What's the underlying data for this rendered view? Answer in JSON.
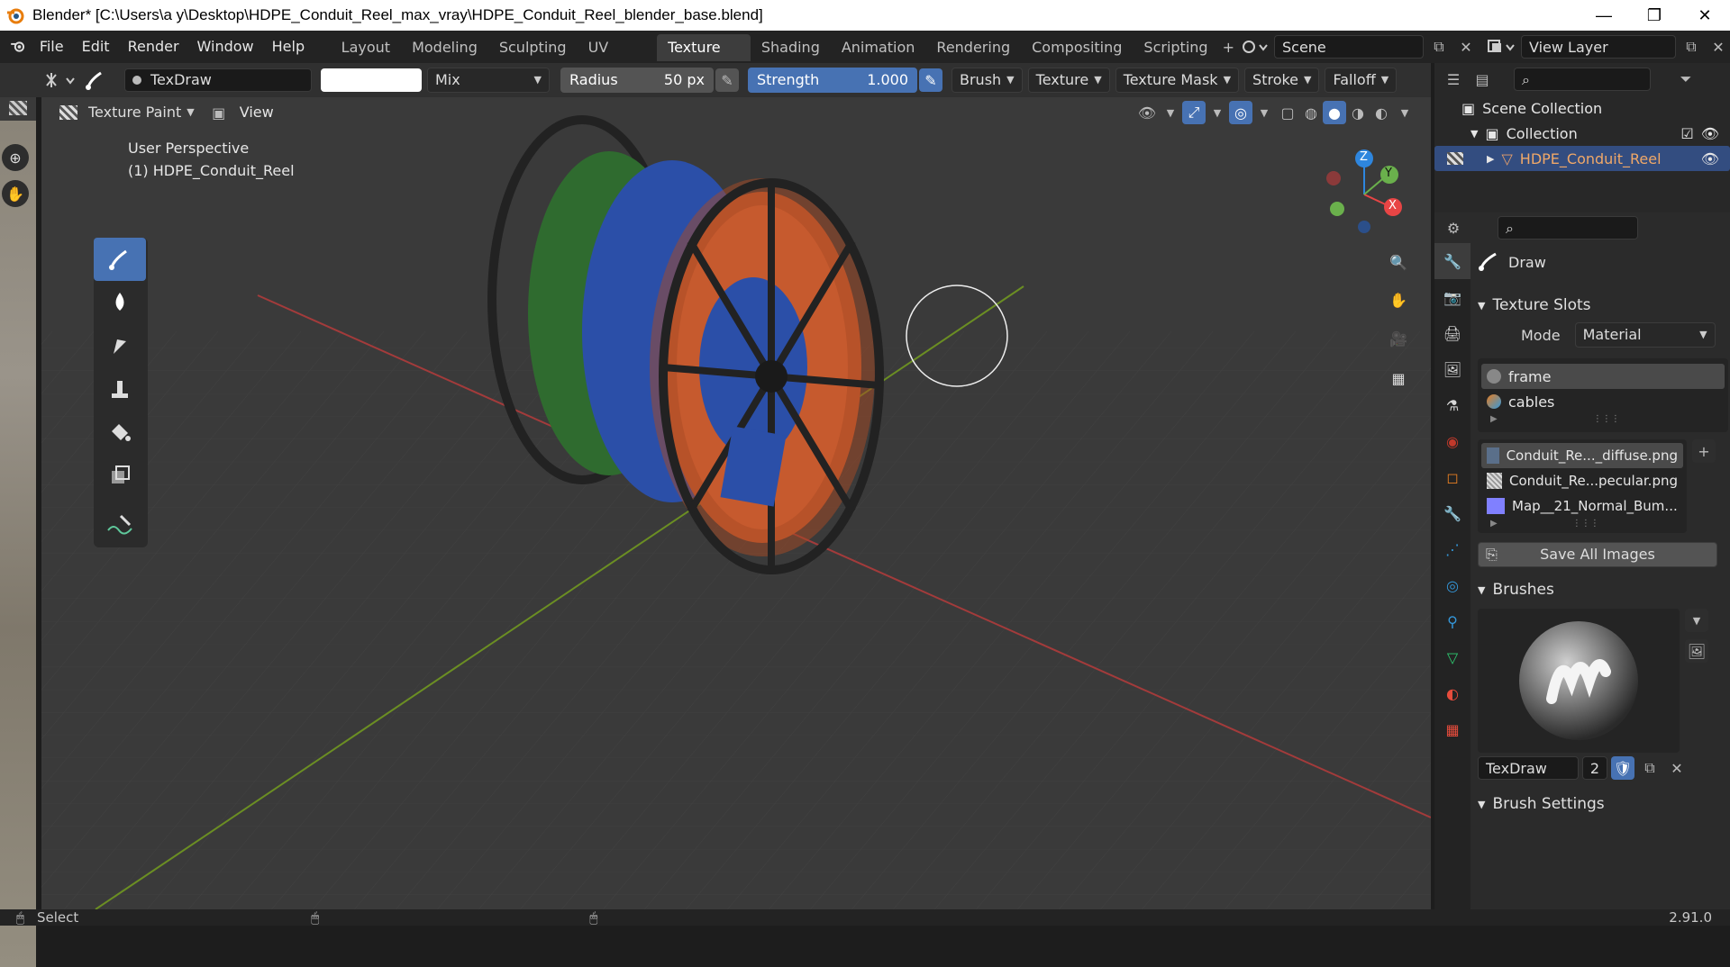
{
  "titlebar": {
    "title": "Blender* [C:\\Users\\a y\\Desktop\\HDPE_Conduit_Reel_max_vray\\HDPE_Conduit_Reel_blender_base.blend]",
    "minimize": "—",
    "restore": "❐",
    "close": "✕"
  },
  "menu": {
    "file": "File",
    "edit": "Edit",
    "render": "Render",
    "window": "Window",
    "help": "Help"
  },
  "workspaces": [
    "Layout",
    "Modeling",
    "Sculpting",
    "UV Editing",
    "Texture Paint",
    "Shading",
    "Animation",
    "Rendering",
    "Compositing",
    "Scripting"
  ],
  "workspace_active": "Texture Paint",
  "workspace_add": "+",
  "scene": {
    "name": "Scene",
    "view_layer": "View Layer"
  },
  "tool_header": {
    "brush_name": "TexDraw",
    "blend_mode": "Mix",
    "radius_label": "Radius",
    "radius_value": "50 px",
    "strength_label": "Strength",
    "strength_value": "1.000",
    "menus": [
      "Brush",
      "Texture",
      "Texture Mask",
      "Stroke",
      "Falloff"
    ]
  },
  "viewport_header": {
    "mode": "Texture Paint",
    "view": "View"
  },
  "viewport": {
    "perspective": "User Perspective",
    "object_label": "(1) HDPE_Conduit_Reel",
    "gizmo": {
      "x": "X",
      "y": "Y",
      "z": "Z"
    }
  },
  "outliner": {
    "scene_collection": "Scene Collection",
    "collection": "Collection",
    "object": "HDPE_Conduit_Reel"
  },
  "properties": {
    "tool_name": "Draw",
    "texture_slots": {
      "title": "Texture Slots",
      "mode_label": "Mode",
      "mode_value": "Material",
      "materials": [
        "frame",
        "cables"
      ],
      "images": [
        "Conduit_Re..._diffuse.png",
        "Conduit_Re...pecular.png",
        "Map__21_Normal_Bum..."
      ],
      "save_all": "Save All Images"
    },
    "brushes": {
      "title": "Brushes",
      "brush_name": "TexDraw",
      "users": "2"
    },
    "brush_settings": "Brush Settings"
  },
  "statusbar": {
    "select": "Select",
    "version": "2.91.0"
  }
}
